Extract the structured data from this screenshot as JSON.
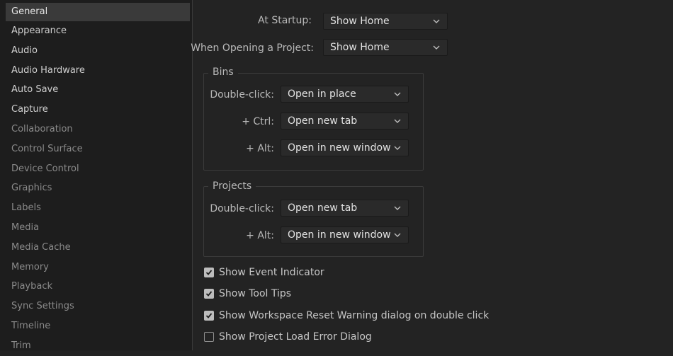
{
  "sidebar": {
    "items": [
      {
        "label": "General",
        "selected": true
      },
      {
        "label": "Appearance"
      },
      {
        "label": "Audio"
      },
      {
        "label": "Audio Hardware"
      },
      {
        "label": "Auto Save"
      },
      {
        "label": "Capture"
      },
      {
        "label": "Collaboration"
      },
      {
        "label": "Control Surface"
      },
      {
        "label": "Device Control"
      },
      {
        "label": "Graphics"
      },
      {
        "label": "Labels"
      },
      {
        "label": "Media"
      },
      {
        "label": "Media Cache"
      },
      {
        "label": "Memory"
      },
      {
        "label": "Playback"
      },
      {
        "label": "Sync Settings"
      },
      {
        "label": "Timeline"
      },
      {
        "label": "Trim"
      }
    ]
  },
  "general": {
    "at_startup": {
      "label": "At Startup:",
      "value": "Show Home"
    },
    "when_opening": {
      "label": "When Opening a Project:",
      "value": "Show Home"
    }
  },
  "bins": {
    "title": "Bins",
    "double_click": {
      "label": "Double-click:",
      "value": "Open in place"
    },
    "ctrl": {
      "label": "+ Ctrl:",
      "value": "Open new tab"
    },
    "alt": {
      "label": "+ Alt:",
      "value": "Open in new window"
    }
  },
  "projects": {
    "title": "Projects",
    "double_click": {
      "label": "Double-click:",
      "value": "Open new tab"
    },
    "alt": {
      "label": "+ Alt:",
      "value": "Open in new window"
    }
  },
  "checkboxes": {
    "event_indicator": {
      "label": "Show Event Indicator",
      "checked": true
    },
    "tool_tips": {
      "label": "Show Tool Tips",
      "checked": true
    },
    "workspace_reset": {
      "label": "Show Workspace Reset Warning dialog on double click",
      "checked": true
    },
    "project_load_error": {
      "label": "Show Project Load Error Dialog",
      "checked": false
    }
  },
  "icons": {
    "dropdown": "chevron-down-icon",
    "check": "checkmark-icon"
  },
  "colors": {
    "background": "#232323",
    "sidebar": "#1d1d1d",
    "selected": "#3a3a3a",
    "text": "#b9b9b9"
  }
}
